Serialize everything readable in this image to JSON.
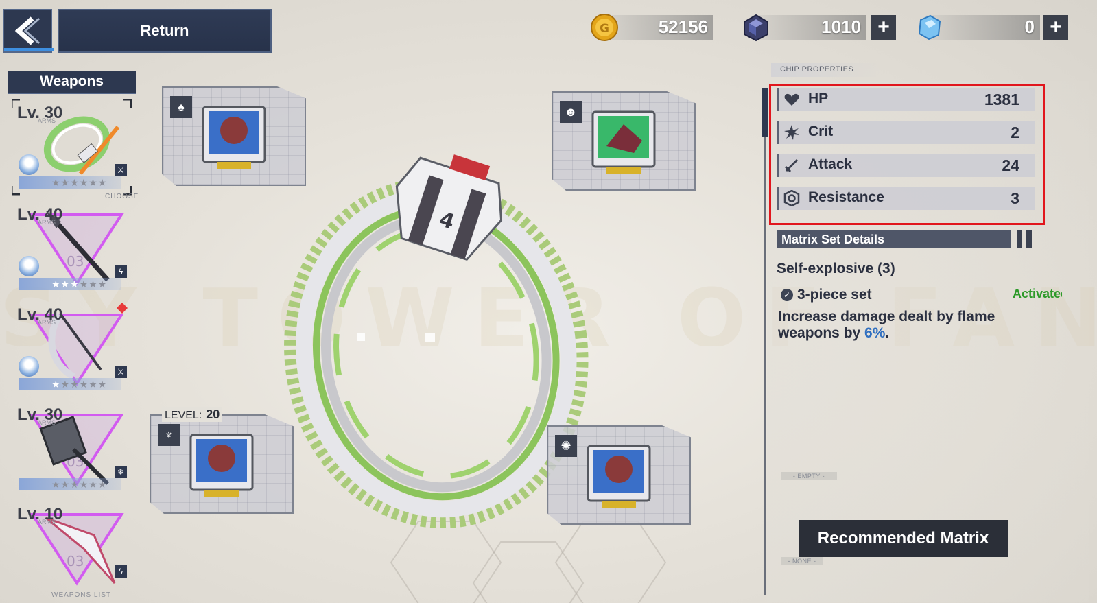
{
  "watermark": "SY TOWER OF FANTA",
  "header": {
    "return_label": "Return",
    "gold": "52156",
    "dark_crystal": "1010",
    "tanium": "0",
    "plus_label": "+"
  },
  "colors": {
    "panel_dark": "#2d3850",
    "accent_blue": "#3e8fe0",
    "highlight_red": "#e1161d",
    "activated_green": "#2e9a2a",
    "percent_blue": "#2f6fc0"
  },
  "sidebar": {
    "title": "Weapons",
    "choose_label": "CHOOSE",
    "list_label": "WEAPONS LIST",
    "arms_label": "ARMS",
    "weapons": [
      {
        "level": "Lv. 30",
        "stars": 0,
        "element": "physical-icon",
        "selected": true
      },
      {
        "level": "Lv. 40",
        "stars": 3,
        "element": "volt-icon",
        "selected": false
      },
      {
        "level": "Lv. 40",
        "stars": 1,
        "element": "physical-icon",
        "selected": false
      },
      {
        "level": "Lv. 30",
        "stars": 0,
        "element": "frost-icon",
        "selected": false
      },
      {
        "level": "Lv. 10",
        "stars": 0,
        "element": "volt-icon",
        "selected": false
      }
    ]
  },
  "chips": [
    {
      "slot": "top-left",
      "icon": "spade-icon"
    },
    {
      "slot": "top-right",
      "icon": "head-icon"
    },
    {
      "slot": "bottom-left",
      "icon": "crest-icon",
      "level_label": "LEVEL:",
      "level": "20"
    },
    {
      "slot": "bottom-right",
      "icon": "brain-icon"
    }
  ],
  "panel": {
    "chip_properties_label": "CHIP PROPERTIES",
    "stats": [
      {
        "name": "HP",
        "value": "1381",
        "icon": "heart-icon"
      },
      {
        "name": "Crit",
        "value": "2",
        "icon": "burst-icon"
      },
      {
        "name": "Attack",
        "value": "24",
        "icon": "sword-icon"
      },
      {
        "name": "Resistance",
        "value": "3",
        "icon": "shield-icon"
      }
    ],
    "matrix_set_title": "Matrix Set Details",
    "set_name": "Self-explosive (3)",
    "piece_label": "3-piece set",
    "activated_label": "Activated",
    "desc_before": "Increase damage dealt by flame weapons by ",
    "desc_pct": "6%",
    "desc_after": ".",
    "empty_label": "- EMPTY -",
    "none_label": "- NONE -",
    "recommended_button": "Recommended Matrix"
  }
}
